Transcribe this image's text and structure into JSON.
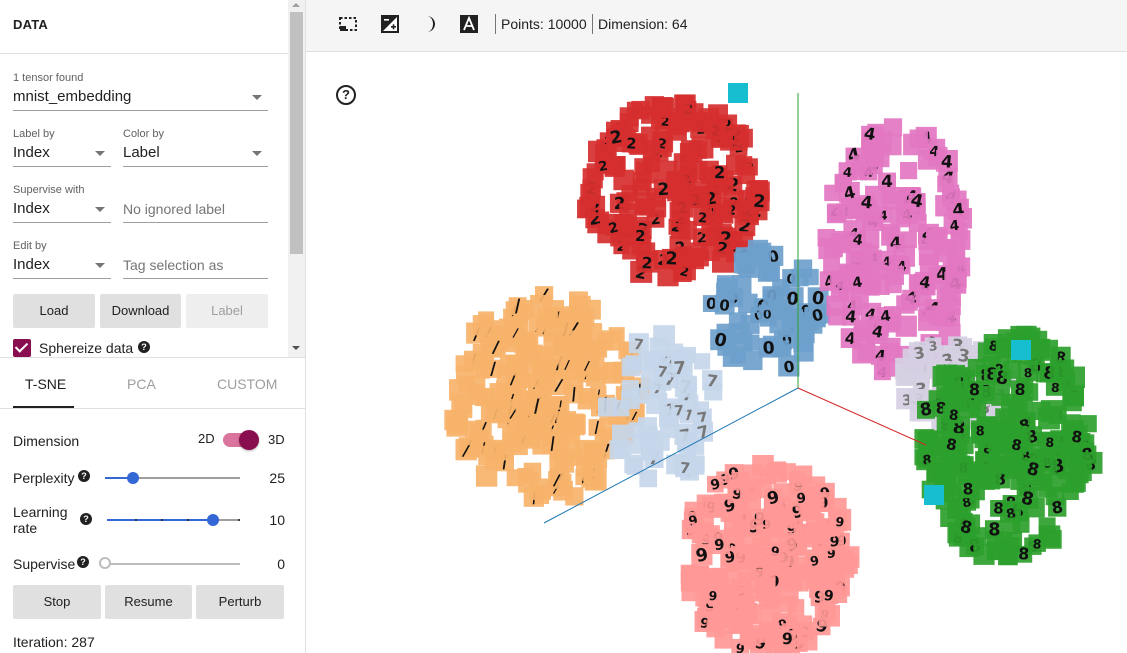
{
  "data_panel": {
    "title": "DATA",
    "tensors_found": "1 tensor found",
    "tensor_selected": "mnist_embedding",
    "label_by_label": "Label by",
    "label_by_value": "Index",
    "color_by_label": "Color by",
    "color_by_value": "Label",
    "supervise_with_label": "Supervise with",
    "supervise_with_value": "Index",
    "ignored_label_placeholder": "No ignored label",
    "edit_by_label": "Edit by",
    "edit_by_value": "Index",
    "tag_selection_placeholder": "Tag selection as",
    "buttons": {
      "load": "Load",
      "download": "Download",
      "label": "Label"
    },
    "sphereize_label": "Sphereize data",
    "sphereize_checked": true
  },
  "projection_tabs": [
    "T-SNE",
    "PCA",
    "CUSTOM"
  ],
  "active_tab": "T-SNE",
  "tsne": {
    "dimension_label": "Dimension",
    "dim_2d": "2D",
    "dim_3d": "3D",
    "dimension_is_3d": true,
    "perplexity_label": "Perplexity",
    "perplexity_value": "25",
    "perplexity_fraction": 0.21,
    "learning_rate_label": "Learning rate",
    "learning_rate_value": "10",
    "learning_rate_fraction": 0.8,
    "supervise_label": "Supervise",
    "supervise_value": "0",
    "supervise_fraction": 0.0,
    "buttons": {
      "stop": "Stop",
      "resume": "Resume",
      "perturb": "Perturb"
    },
    "iteration_text": "Iteration: 287"
  },
  "toolbar": {
    "points_text": "Points: 10000",
    "dimension_text": "Dimension: 64",
    "icons": [
      "select-rectangle-icon",
      "night-mode-icon",
      "moon-icon",
      "label-a-icon"
    ]
  },
  "projection": {
    "help_glyph": "?",
    "cluster_colors": {
      "digit_0": "#6e9fcc",
      "digit_1": "#f7b36b",
      "digit_2": "#d62f2f",
      "digit_3": "#d6cfe3",
      "digit_4": "#e377c2",
      "digit_7": "#c5d6ea",
      "digit_8": "#2ca02c",
      "digit_9": "#ff9896",
      "accent_cyan": "#17becf"
    },
    "cluster_digits": {
      "digit_0": "0",
      "digit_1": "/",
      "digit_2": "2",
      "digit_3": "3",
      "digit_4": "4",
      "digit_7": "7",
      "digit_8": "8",
      "digit_9": "9"
    },
    "axis_colors": {
      "x": "#d62728",
      "y": "#2ca02c",
      "z": "#1f77b4"
    }
  }
}
